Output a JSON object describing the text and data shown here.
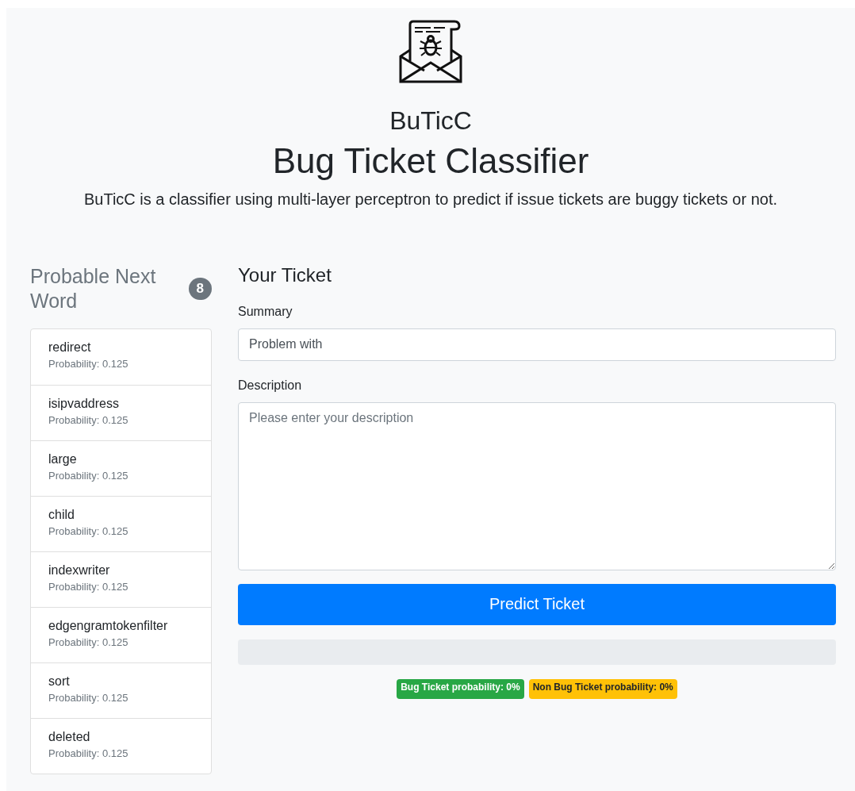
{
  "header": {
    "app_name": "BuTicC",
    "title": "Bug Ticket Classifier",
    "description": "BuTicC is a classifier using multi-layer perceptron to predict if issue tickets are buggy tickets or not."
  },
  "sidebar": {
    "heading": "Probable Next Word",
    "count": "8",
    "words": [
      {
        "word": "redirect",
        "probability": "Probability: 0.125"
      },
      {
        "word": "isipvaddress",
        "probability": "Probability: 0.125"
      },
      {
        "word": "large",
        "probability": "Probability: 0.125"
      },
      {
        "word": "child",
        "probability": "Probability: 0.125"
      },
      {
        "word": "indexwriter",
        "probability": "Probability: 0.125"
      },
      {
        "word": "edgengramtokenfilter",
        "probability": "Probability: 0.125"
      },
      {
        "word": "sort",
        "probability": "Probability: 0.125"
      },
      {
        "word": "deleted",
        "probability": "Probability: 0.125"
      }
    ]
  },
  "form": {
    "heading": "Your Ticket",
    "summary": {
      "label": "Summary",
      "value": "Problem with"
    },
    "description": {
      "label": "Description",
      "placeholder": "Please enter your description"
    },
    "button": "Predict Ticket",
    "progress": {
      "level": 0
    },
    "badges": [
      {
        "text": "Bug Ticket probability: 0%",
        "color": "#28a745"
      },
      {
        "text": "Non Bug Ticket probability: 0%",
        "color": "#ffc107"
      }
    ]
  }
}
